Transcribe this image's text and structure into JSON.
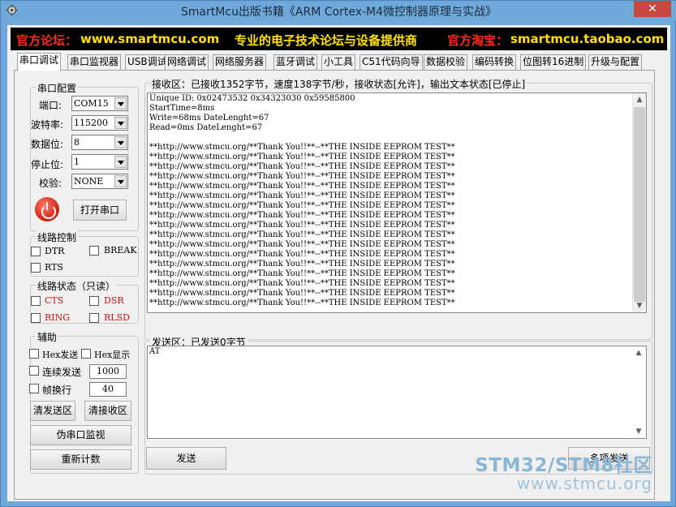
{
  "window": {
    "title": "SmartMcu出版书籍《ARM Cortex-M4微控制器原理与实战》",
    "close_glyph": "✕"
  },
  "banner": {
    "forum_label": "官方论坛：",
    "forum_url": "www.smartmcu.com",
    "slogan": "专业的电子技术论坛与设备提供商",
    "shop_label": "官方淘宝：",
    "shop_url": "smartmcu.taobao.com"
  },
  "tabs": [
    "串口调试",
    "串口监视器",
    "USB调试",
    "网络调试",
    "网络服务器",
    "蓝牙调试",
    "小工具",
    "C51代码向导",
    "数据校验",
    "编码转换",
    "位图转16进制",
    "升级与配置"
  ],
  "serial_config": {
    "title": "串口配置",
    "port_label": "端口:",
    "port_value": "COM15",
    "baud_label": "波特率:",
    "baud_value": "115200",
    "databits_label": "数据位:",
    "databits_value": "8",
    "stopbits_label": "停止位:",
    "stopbits_value": "1",
    "parity_label": "校验:",
    "parity_value": "NONE",
    "open_button": "打开串口",
    "power_icon": "power-icon"
  },
  "line_control": {
    "title": "线路控制",
    "dtr": "DTR",
    "break": "BREAK",
    "rts": "RTS"
  },
  "line_status": {
    "title": "线路状态（只读）",
    "cts": "CTS",
    "dsr": "DSR",
    "ring": "RING",
    "rlsd": "RLSD",
    "status_color": "#d01010"
  },
  "aux": {
    "title": "辅助",
    "hex_send": "Hex发送",
    "hex_display": "Hex显示",
    "continuous_send": "连续发送",
    "continuous_interval": "1000",
    "frame_newline": "帧换行",
    "frame_value": "40",
    "clear_send": "清发送区",
    "clear_recv": "清接收区",
    "pseudo_monitor": "伪串口监视",
    "reset_count": "重新计数"
  },
  "receive": {
    "header": "接收区：已接收1352字节，速度138字节/秒，接收状态[允许]，输出文本状态[已停止]",
    "lines": [
      "Unique ID: 0x02473532 0x34323030 0x59585800",
      "StartTime=8ms",
      "Write=68ms DateLenght=67",
      "Read=0ms DateLenght=67",
      "",
      "**http://www.stmcu.org/**Thank You!!**--**THE INSIDE EEPROM TEST**",
      "**http://www.stmcu.org/**Thank You!!**--**THE INSIDE EEPROM TEST**",
      "**http://www.stmcu.org/**Thank You!!**--**THE INSIDE EEPROM TEST**",
      "**http://www.stmcu.org/**Thank You!!**--**THE INSIDE EEPROM TEST**",
      "**http://www.stmcu.org/**Thank You!!**--**THE INSIDE EEPROM TEST**",
      "**http://www.stmcu.org/**Thank You!!**--**THE INSIDE EEPROM TEST**",
      "**http://www.stmcu.org/**Thank You!!**--**THE INSIDE EEPROM TEST**",
      "**http://www.stmcu.org/**Thank You!!**--**THE INSIDE EEPROM TEST**",
      "**http://www.stmcu.org/**Thank You!!**--**THE INSIDE EEPROM TEST**",
      "**http://www.stmcu.org/**Thank You!!**--**THE INSIDE EEPROM TEST**",
      "**http://www.stmcu.org/**Thank You!!**--**THE INSIDE EEPROM TEST**",
      "**http://www.stmcu.org/**Thank You!!**--**THE INSIDE EEPROM TEST**",
      "**http://www.stmcu.org/**Thank You!!**--**THE INSIDE EEPROM TEST**",
      "**http://www.stmcu.org/**Thank You!!**--**THE INSIDE EEPROM TEST**",
      "**http://www.stmcu.org/**Thank You!!**--**THE INSIDE EEPROM TEST**",
      "**http://www.stmcu.org/**Thank You!!**--**THE INSIDE EEPROM TEST**",
      "**http://www.stmcu.org/**Thank You!!**--**THE INSIDE EEPROM TEST**"
    ]
  },
  "send": {
    "header": "发送区：已发送0字节",
    "text": "AT",
    "send_button": "发送",
    "multi_send_button": "多项发送"
  },
  "watermark": {
    "line1": "STM32/STM8社区",
    "line2": "www.stmcu.org"
  }
}
